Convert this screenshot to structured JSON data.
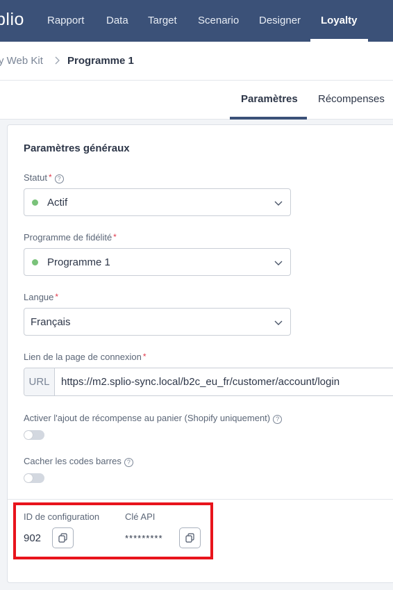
{
  "topnav": {
    "logo": "plio",
    "items": [
      {
        "label": "Rapport"
      },
      {
        "label": "Data"
      },
      {
        "label": "Target"
      },
      {
        "label": "Scenario"
      },
      {
        "label": "Designer"
      },
      {
        "label": "Loyalty"
      }
    ],
    "active": "Loyalty"
  },
  "breadcrumb": {
    "previous": "y Web Kit",
    "current": "Programme 1"
  },
  "tabs": [
    {
      "label": "Paramètres"
    },
    {
      "label": "Récompenses"
    }
  ],
  "form": {
    "section_title": "Paramètres généraux",
    "statut": {
      "label": "Statut",
      "required": "*",
      "value": "Actif",
      "status_color": "#7ac27a"
    },
    "programme": {
      "label": "Programme de fidélité",
      "required": "*",
      "value": "Programme 1",
      "status_color": "#7ac27a"
    },
    "langue": {
      "label": "Langue",
      "required": "*",
      "value": "Français"
    },
    "lien": {
      "label": "Lien de la page de connexion",
      "required": "*",
      "prefix": "URL",
      "value": "https://m2.splio-sync.local/b2c_eu_fr/customer/account/login"
    },
    "toggle_reward": {
      "label": "Activer l'ajout de récompense au panier (Shopify uniquement)",
      "checked": false
    },
    "toggle_barcodes": {
      "label": "Cacher les codes barres",
      "checked": false
    }
  },
  "config": {
    "id_label": "ID de configuration",
    "id_value": "902",
    "api_label": "Clé API",
    "api_value": "*********"
  },
  "colors": {
    "nav_bg": "#3b5178",
    "highlight": "#e8141c",
    "required": "#e0384b"
  }
}
